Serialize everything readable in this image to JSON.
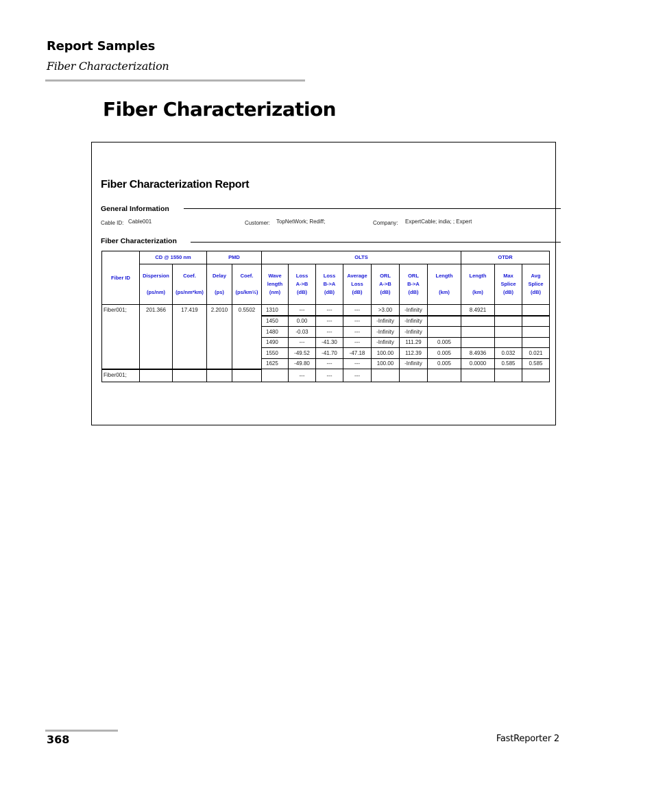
{
  "header": {
    "section": "Report Samples",
    "subsection": "Fiber Characterization"
  },
  "page_title": "Fiber Characterization",
  "report": {
    "title": "Fiber Characterization Report",
    "general_info": {
      "heading": "General Information",
      "cable_id_label": "Cable ID:",
      "cable_id": "Cable001",
      "customer_label": "Customer:",
      "customer": "TopNetWork; Rediff;",
      "company_label": "Company:",
      "company": "ExpertCable; india; ; Expert"
    },
    "fiber_char": {
      "heading": "Fiber Characterization",
      "groups": {
        "fiber_id": "Fiber ID",
        "cd": "CD @ 1550 nm",
        "pmd": "PMD",
        "olts": "OLTS",
        "otdr": "OTDR"
      },
      "columns": {
        "dispersion": [
          "Dispersion",
          "(ps/nm)"
        ],
        "cd_coef": [
          "Coef.",
          "(ps/nm*km)"
        ],
        "delay": [
          "Delay",
          "(ps)"
        ],
        "pmd_coef": [
          "Coef.",
          "(ps/km½)"
        ],
        "wavelength": [
          "Wave",
          "length",
          "(nm)"
        ],
        "loss_ab": [
          "Loss",
          "A->B",
          "(dB)"
        ],
        "loss_ba": [
          "Loss",
          "B->A",
          "(dB)"
        ],
        "avg_loss": [
          "Average",
          "Loss",
          "(dB)"
        ],
        "orl_ab": [
          "ORL",
          "A->B",
          "(dB)"
        ],
        "orl_ba": [
          "ORL",
          "B->A",
          "(dB)"
        ],
        "olts_length": [
          "Length",
          "(km)"
        ],
        "otdr_length": [
          "Length",
          "(km)"
        ],
        "max_splice": [
          "Max",
          "Splice",
          "(dB)"
        ],
        "avg_splice": [
          "Avg",
          "Splice",
          "(dB)"
        ]
      },
      "fibers": [
        {
          "fiber_id": "Fiber001;",
          "dispersion": "201.366",
          "cd_coef": "17.419",
          "delay": "2.2010",
          "pmd_coef": "0.5502",
          "rows": [
            {
              "wavelength": "1310",
              "loss_ab": "---",
              "loss_ba": "---",
              "avg_loss": "---",
              "orl_ab": ">3.00",
              "orl_ba": "-Infinity",
              "olts_length": "",
              "otdr_length": "8.4921",
              "max_splice": "",
              "avg_splice": ""
            },
            {
              "wavelength": "1450",
              "loss_ab": "0.00",
              "loss_ba": "---",
              "avg_loss": "---",
              "orl_ab": "-Infinity",
              "orl_ba": "-Infinity",
              "olts_length": "",
              "otdr_length": "",
              "max_splice": "",
              "avg_splice": ""
            },
            {
              "wavelength": "1480",
              "loss_ab": "-0.03",
              "loss_ba": "---",
              "avg_loss": "---",
              "orl_ab": "-Infinity",
              "orl_ba": "-Infinity",
              "olts_length": "",
              "otdr_length": "",
              "max_splice": "",
              "avg_splice": ""
            },
            {
              "wavelength": "1490",
              "loss_ab": "---",
              "loss_ba": "-41.30",
              "avg_loss": "---",
              "orl_ab": "-Infinity",
              "orl_ba": "111.29",
              "olts_length": "0.005",
              "otdr_length": "",
              "max_splice": "",
              "avg_splice": ""
            },
            {
              "wavelength": "1550",
              "loss_ab": "-49.52",
              "loss_ba": "-41.70",
              "avg_loss": "-47.18",
              "orl_ab": "100.00",
              "orl_ba": "112.39",
              "olts_length": "0.005",
              "otdr_length": "8.4936",
              "max_splice": "0.032",
              "avg_splice": "0.021"
            },
            {
              "wavelength": "1625",
              "loss_ab": "-49.80",
              "loss_ba": "---",
              "avg_loss": "---",
              "orl_ab": "100.00",
              "orl_ba": "-Infinity",
              "olts_length": "0.005",
              "otdr_length": "0.0000",
              "max_splice": "0.585",
              "avg_splice": "0.585"
            }
          ]
        },
        {
          "fiber_id": "Fiber001;",
          "dispersion": "",
          "cd_coef": "",
          "delay": "",
          "pmd_coef": "",
          "rows": [
            {
              "wavelength": "",
              "loss_ab": "---",
              "loss_ba": "---",
              "avg_loss": "---",
              "orl_ab": "",
              "orl_ba": "",
              "olts_length": "",
              "otdr_length": "",
              "max_splice": "",
              "avg_splice": ""
            }
          ]
        }
      ]
    }
  },
  "footer": {
    "page_number": "368",
    "product": "FastReporter 2"
  }
}
